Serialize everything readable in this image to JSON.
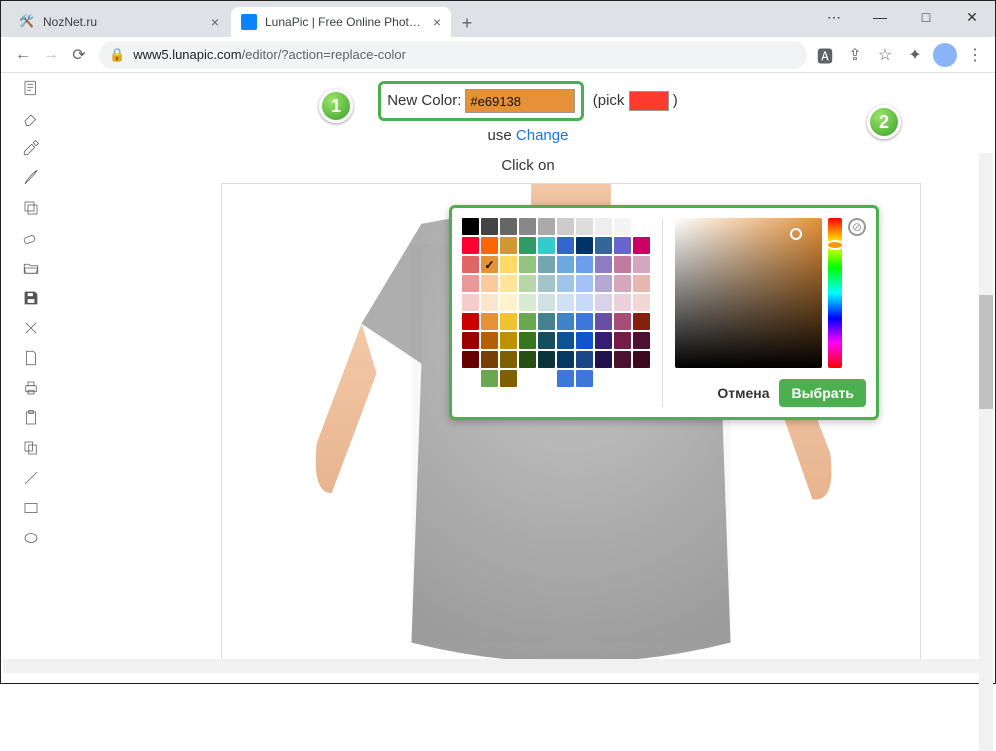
{
  "window": {
    "minimize": "—",
    "maximize": "□",
    "close": "✕"
  },
  "tabs": [
    {
      "title": "NozNet.ru",
      "active": false
    },
    {
      "title": "LunaPic | Free Online Photo Editor",
      "active": true
    }
  ],
  "addressbar": {
    "back": "←",
    "forward": "→",
    "reload": "⟳",
    "host": "www5.lunapic.com",
    "path": "/editor/?action=replace-color"
  },
  "sidebar_tools": [
    "note",
    "eraser",
    "eyedropper",
    "brush",
    "layers",
    "eraser2",
    "open",
    "save",
    "close",
    "new",
    "print",
    "clipboard",
    "copy",
    "line",
    "rect",
    "ellipse"
  ],
  "replace_color": {
    "label": "New Color:",
    "hex_value": "#e69138",
    "pick_open": "(pick",
    "pick_close": ")",
    "pick_swatch": "#ff3b2f",
    "line2_pre": "use ",
    "line2_link": "Change",
    "line3": "Click on"
  },
  "picker": {
    "cancel": "Отмена",
    "choose": "Выбрать",
    "selected_hex": "#e69138",
    "selected_index": 21,
    "hue_hex": "#ff9800",
    "palette": [
      "#000000",
      "#444444",
      "#666666",
      "#888888",
      "#aaaaaa",
      "#cccccc",
      "#dddddd",
      "#eeeeee",
      "#f4f4f4",
      "#ffffff",
      "#ff0033",
      "#ff6600",
      "#cc9933",
      "#339966",
      "#33cccc",
      "#3366cc",
      "#003366",
      "#336699",
      "#6666cc",
      "#cc0066",
      "#e06666",
      "#e69138",
      "#ffd966",
      "#93c47d",
      "#76a5af",
      "#6fa8dc",
      "#6d9eeb",
      "#8e7cc3",
      "#c27ba0",
      "#d5a6bd",
      "#ea9999",
      "#f9cb9c",
      "#ffe599",
      "#b6d7a8",
      "#a2c4c9",
      "#9fc5e8",
      "#a4c2f4",
      "#b4a7d6",
      "#d5a6bd",
      "#e6b8af",
      "#f4cccc",
      "#fce5cd",
      "#fff2cc",
      "#d9ead3",
      "#d0e0e3",
      "#cfe2f3",
      "#c9daf8",
      "#d9d2e9",
      "#ead1dc",
      "#f2d7d5",
      "#cc0000",
      "#e69138",
      "#f1c232",
      "#6aa84f",
      "#45818e",
      "#3d85c6",
      "#3c78d8",
      "#674ea7",
      "#a64d79",
      "#85200c",
      "#990000",
      "#b45f06",
      "#bf9000",
      "#38761d",
      "#134f5c",
      "#0b5394",
      "#1155cc",
      "#351c75",
      "#741b47",
      "#4c1130",
      "#660000",
      "#783f04",
      "#7f6000",
      "#274e13",
      "#0c343d",
      "#073763",
      "#1c4587",
      "#20124d",
      "#4c1130",
      "#3b0a1e",
      "#ffffff",
      "#6aa84f",
      "#7f6000",
      "",
      "",
      "#3c78d8",
      "#3c78d8",
      "",
      "",
      ""
    ]
  },
  "annotations": {
    "badge1": "1",
    "badge2": "2"
  }
}
